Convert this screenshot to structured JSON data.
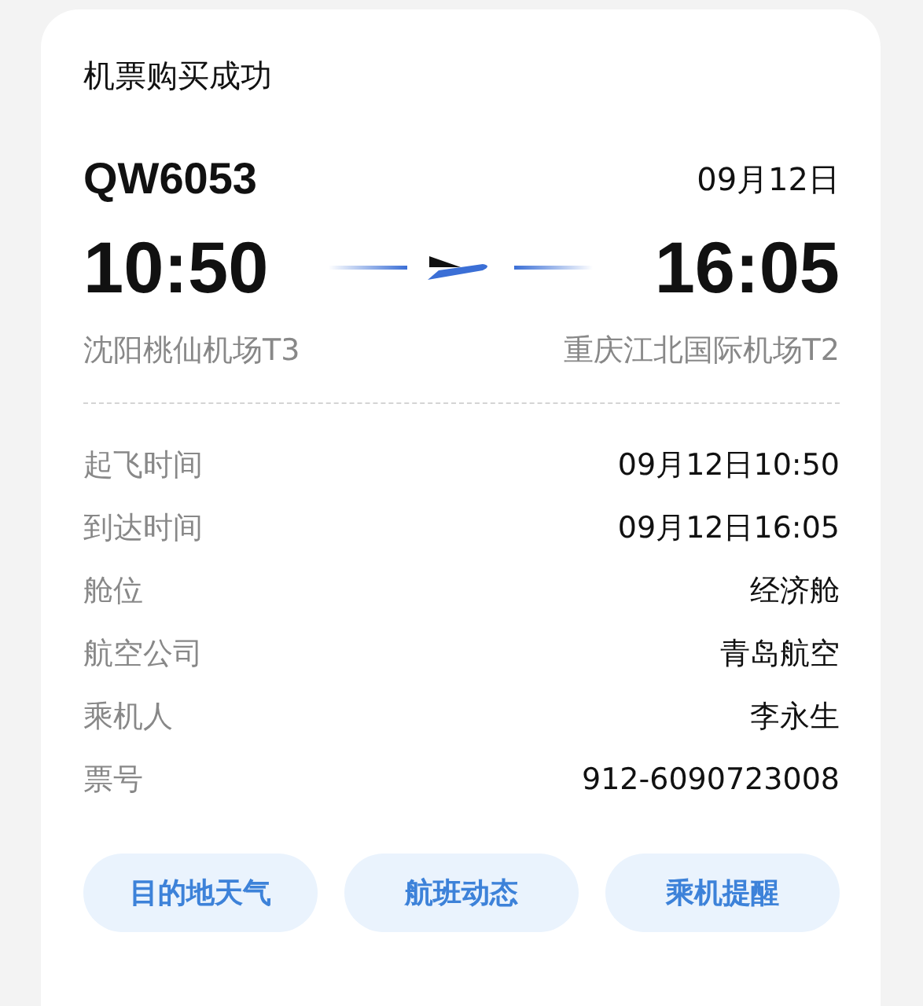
{
  "title": "机票购买成功",
  "flight": {
    "number": "QW6053",
    "date": "09月12日",
    "depart_time": "10:50",
    "arrive_time": "16:05",
    "depart_airport": "沈阳桃仙机场T3",
    "arrive_airport": "重庆江北国际机场T2"
  },
  "details": [
    {
      "label": "起飞时间",
      "value": "09月12日10:50"
    },
    {
      "label": "到达时间",
      "value": "09月12日16:05"
    },
    {
      "label": "舱位",
      "value": "经济舱"
    },
    {
      "label": "航空公司",
      "value": "青岛航空"
    },
    {
      "label": "乘机人",
      "value": "李永生"
    },
    {
      "label": "票号",
      "value": "912-6090723008"
    }
  ],
  "buttons": [
    "目的地天气",
    "航班动态",
    "乘机提醒"
  ]
}
